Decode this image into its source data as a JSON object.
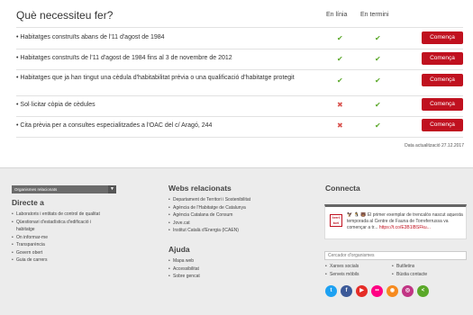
{
  "header": {
    "title": "Què necessiteu fer?",
    "col_online": "En línia",
    "col_term": "En termini"
  },
  "rows": [
    {
      "label": "Habitatges construïts abans de l'11 d'agost de 1984",
      "online": "check",
      "term": "check",
      "button": "Comença"
    },
    {
      "label": "Habitatges construïts de l'11 d'agost de 1984 fins al 3 de novembre de 2012",
      "online": "check",
      "term": "check",
      "button": "Comença"
    },
    {
      "label": "Habitatges que ja han tingut una cèdula d'habitabilitat prèvia o una qualificació d'habitatge protegit",
      "online": "check",
      "term": "check",
      "button": "Comença"
    },
    {
      "label": "Sol·licitar còpia de cèdules",
      "online": "cross",
      "term": "check",
      "button": "Comença"
    },
    {
      "label": "Cita prèvia per a consultes especialitzades a l'OAC del c/ Aragó, 244",
      "online": "cross",
      "term": "check",
      "button": "Comença"
    }
  ],
  "update_text": "Data actualització 27.12.2017",
  "footer": {
    "org_select": "Organismes relacionats",
    "directe": {
      "title": "Directe a",
      "items": [
        "Laboratoris i entitats de control de qualitat",
        "Qüestionari d'estadística d'edificació i habitatge",
        "On informar-me",
        "Transparència",
        "Govern obert",
        "Guia de carrers"
      ]
    },
    "webs": {
      "title": "Webs relacionats",
      "items": [
        "Departament de Territori i Sostenibilitat",
        "Agència de l'Habitatge de Catalunya",
        "Agència Catalana de Consum",
        "Jove.cat",
        "Institut Català d'Energia (ICAEN)"
      ]
    },
    "ajuda": {
      "title": "Ajuda",
      "items": [
        "Mapa web",
        "Accessibilitat",
        "Sobre gencat"
      ]
    },
    "connecta": {
      "title": "Connecta",
      "tweet_prefix": "🦅 🐧 🐻 ",
      "tweet_text": "El primer exemplar de trencalòs nascut aquesta temporada al Centre de Fauna de Torreferrussa va començar a tr...",
      "tweet_link": "https://t.co/E3B1lBSFku...",
      "logo_text": "terri tori",
      "search_placeholder": "Cercador d'organismes",
      "links_left": [
        "Xarxes socials",
        "Serveis mòbils"
      ],
      "links_right": [
        "Butlletins",
        "Bústia contacte"
      ]
    }
  },
  "socials": [
    {
      "name": "twitter",
      "color": "#1da1f2",
      "glyph": "t"
    },
    {
      "name": "facebook",
      "color": "#3b5998",
      "glyph": "f"
    },
    {
      "name": "youtube",
      "color": "#e52d27",
      "glyph": "▶"
    },
    {
      "name": "flickr",
      "color": "#ff0084",
      "glyph": "••"
    },
    {
      "name": "ivoox",
      "color": "#f68a1f",
      "glyph": "◉"
    },
    {
      "name": "instagram",
      "color": "#c13584",
      "glyph": "◎"
    },
    {
      "name": "share",
      "color": "#5aa829",
      "glyph": "<"
    }
  ]
}
